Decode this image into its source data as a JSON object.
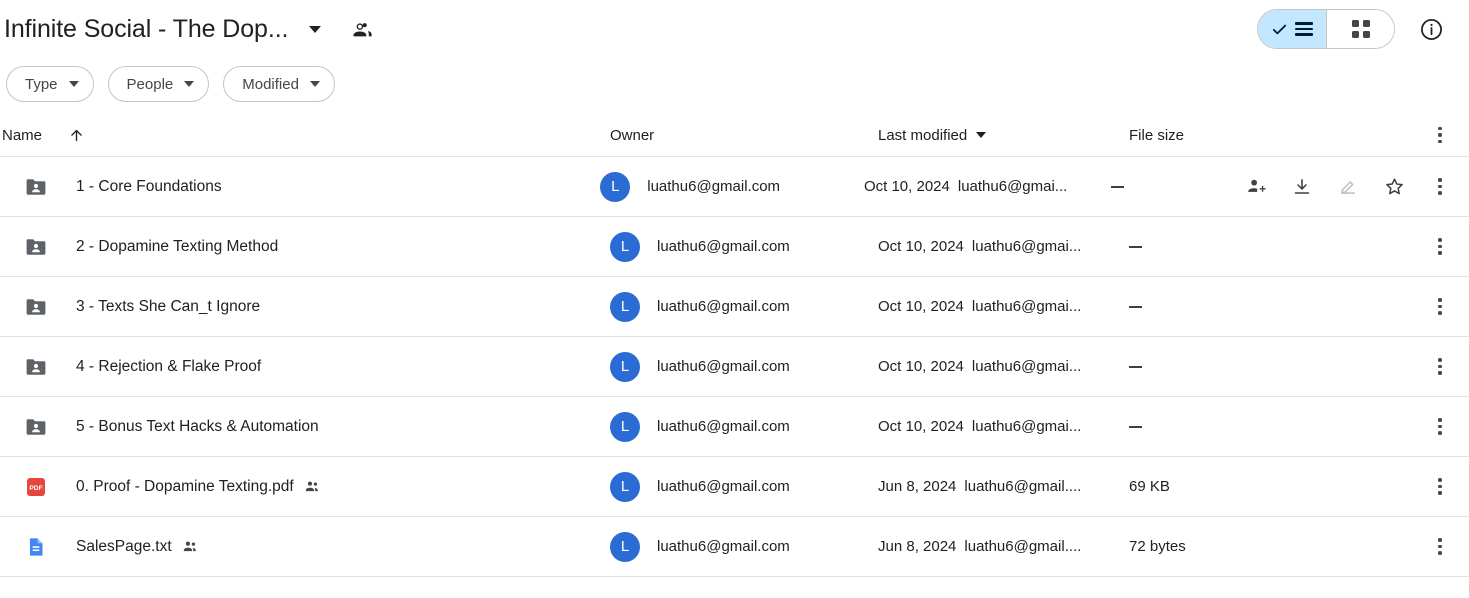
{
  "header": {
    "title": "Infinite Social - The Dop...",
    "title_caret_icon": "chevron-down-icon",
    "shared_icon": "people-shared-icon",
    "view_list_label": "",
    "view_grid_label": "",
    "info_label": "i",
    "icons": {
      "list_view": "list-view-icon",
      "grid_view": "grid-view-icon",
      "info": "info-icon",
      "check": "check-icon"
    }
  },
  "filters": [
    {
      "label": "Type",
      "icon": "chevron-down-icon"
    },
    {
      "label": "People",
      "icon": "chevron-down-icon"
    },
    {
      "label": "Modified",
      "icon": "chevron-down-icon"
    }
  ],
  "columns": {
    "name": "Name",
    "sort_icon": "arrow-up-icon",
    "owner": "Owner",
    "last_modified": "Last modified",
    "last_modified_icon": "chevron-down-icon",
    "file_size": "File size",
    "overflow_icon": "more-vert-icon"
  },
  "row_actions": {
    "share": "person-add-icon",
    "download": "download-icon",
    "edit": "pencil-icon",
    "star": "star-icon",
    "more": "more-vert-icon"
  },
  "rows": [
    {
      "icon": "shared-folder-icon",
      "type": "folder",
      "name": "1 - Core Foundations",
      "shared": false,
      "owner": "luathu6@gmail.com",
      "avatar": "L",
      "modified_date": "Oct 10, 2024",
      "modified_by": "luathu6@gmai...",
      "size": "—",
      "hovered": true
    },
    {
      "icon": "shared-folder-icon",
      "type": "folder",
      "name": "2 - Dopamine Texting Method",
      "shared": false,
      "owner": "luathu6@gmail.com",
      "avatar": "L",
      "modified_date": "Oct 10, 2024",
      "modified_by": "luathu6@gmai...",
      "size": "—",
      "hovered": false
    },
    {
      "icon": "shared-folder-icon",
      "type": "folder",
      "name": "3 - Texts She Can_t Ignore",
      "shared": false,
      "owner": "luathu6@gmail.com",
      "avatar": "L",
      "modified_date": "Oct 10, 2024",
      "modified_by": "luathu6@gmai...",
      "size": "—",
      "hovered": false
    },
    {
      "icon": "shared-folder-icon",
      "type": "folder",
      "name": "4 - Rejection & Flake Proof",
      "shared": false,
      "owner": "luathu6@gmail.com",
      "avatar": "L",
      "modified_date": "Oct 10, 2024",
      "modified_by": "luathu6@gmai...",
      "size": "—",
      "hovered": false
    },
    {
      "icon": "shared-folder-icon",
      "type": "folder",
      "name": "5 - Bonus Text Hacks & Automation",
      "shared": false,
      "owner": "luathu6@gmail.com",
      "avatar": "L",
      "modified_date": "Oct 10, 2024",
      "modified_by": "luathu6@gmai...",
      "size": "—",
      "hovered": false
    },
    {
      "icon": "pdf-file-icon",
      "type": "pdf",
      "name": "0. Proof - Dopamine Texting.pdf",
      "shared": true,
      "owner": "luathu6@gmail.com",
      "avatar": "L",
      "modified_date": "Jun 8, 2024",
      "modified_by": "luathu6@gmail....",
      "size": "69 KB",
      "hovered": false
    },
    {
      "icon": "text-file-icon",
      "type": "txt",
      "name": "SalesPage.txt",
      "shared": true,
      "owner": "luathu6@gmail.com",
      "avatar": "L",
      "modified_date": "Jun 8, 2024",
      "modified_by": "luathu6@gmail....",
      "size": "72 bytes",
      "hovered": false
    }
  ],
  "colors": {
    "accent_blue": "#2b6bd4",
    "selected_chip": "#c2e7ff",
    "pdf_red": "#e8453c",
    "txt_blue": "#4285f4",
    "folder_gray": "#5f6368",
    "divider": "#e3e3e3"
  }
}
